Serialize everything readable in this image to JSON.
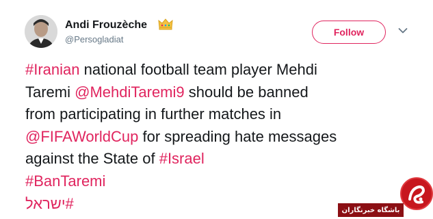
{
  "user": {
    "display_name": "Andi Frouzèche",
    "handle": "@Persogladiat",
    "badge_icon": "crown-icon",
    "avatar_icon": "profile-photo"
  },
  "actions": {
    "follow_label": "Follow",
    "menu_icon": "chevron-down-icon"
  },
  "tweet": {
    "line1": {
      "hashtag": "#Iranian",
      "text": " national football team player Mehdi"
    },
    "line2": {
      "text_before": "Taremi ",
      "mention": "@MehdiTaremi9",
      "text_after": " should be banned"
    },
    "line3": {
      "text": "from participating in further matches in"
    },
    "line4": {
      "hashtag": "@FIFAWorldCup",
      "text": " for spreading hate messages"
    },
    "line5": {
      "text": "against the State of ",
      "hashtag": "#Israel"
    },
    "line6": {
      "hashtag": "#BanTaremi"
    },
    "line7": {
      "hashtag": "#ישראל"
    }
  },
  "watermark": {
    "label": "باشگاه خبرنگاران",
    "logo_icon": "news-agency-logo"
  },
  "colors": {
    "accent": "#e0245e",
    "text": "#14171a",
    "muted": "#657786",
    "watermark_red": "#c7171e"
  }
}
